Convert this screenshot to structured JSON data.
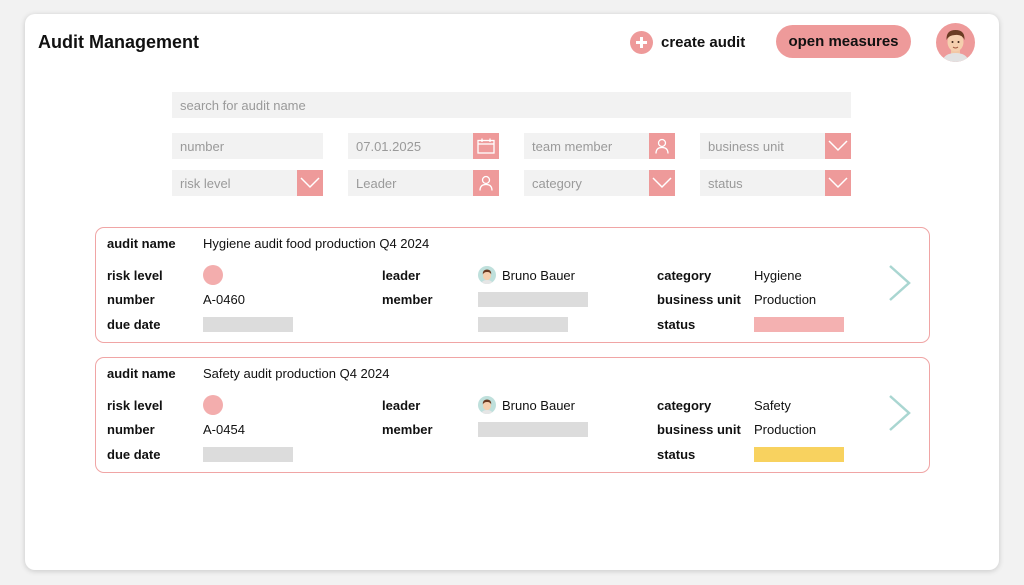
{
  "header": {
    "title": "Audit Management",
    "create_audit_label": "create audit",
    "open_measures_label": "open measures"
  },
  "search": {
    "placeholder": "search for audit name"
  },
  "filters": {
    "number": "number",
    "date": "07.01.2025",
    "team_member": "team member",
    "business_unit": "business unit",
    "risk_level": "risk level",
    "leader": "Leader",
    "category": "category",
    "status": "status"
  },
  "labels": {
    "audit_name": "audit name",
    "risk_level": "risk level",
    "number": "number",
    "due_date": "due date",
    "leader": "leader",
    "member": "member",
    "category": "category",
    "business_unit": "business unit",
    "status": "status"
  },
  "audits": [
    {
      "name": "Hygiene audit food production Q4 2024",
      "number": "A-0460",
      "leader": "Bruno Bauer",
      "category": "Hygiene",
      "business_unit": "Production",
      "risk_color": "#f3adad",
      "status_color": "#f4b1b1"
    },
    {
      "name": "Safety audit production Q4 2024",
      "number": "A-0454",
      "leader": "Bruno Bauer",
      "category": "Safety",
      "business_unit": "Production",
      "risk_color": "#f3adad",
      "status_color": "#f8d25f"
    }
  ],
  "colors": {
    "accent": "#ee9a9a",
    "card_border": "#f0a5a5",
    "chevron": "#a9d6d1",
    "field_bg": "#f2f2f2",
    "placeholder_bar": "#dcdcdc"
  }
}
